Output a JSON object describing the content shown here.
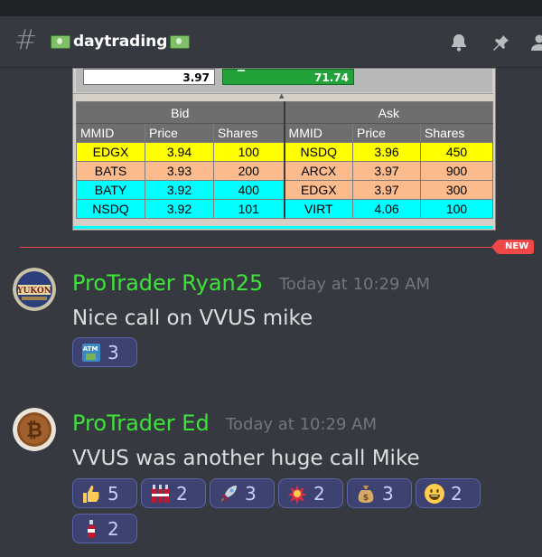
{
  "channel": {
    "name": "daytrading"
  },
  "level2": {
    "top_left_value": "3.97",
    "top_right_value": "71.74",
    "group_headers": [
      "Bid",
      "Ask"
    ],
    "columns": [
      "MMID",
      "Price",
      "Shares",
      "MMID",
      "Price",
      "Shares"
    ],
    "rows": [
      {
        "color": "yellow",
        "cells": [
          "EDGX",
          "3.94",
          "100",
          "NSDQ",
          "3.96",
          "450"
        ]
      },
      {
        "color": "orange",
        "cells": [
          "BATS",
          "3.93",
          "200",
          "ARCX",
          "3.97",
          "900"
        ]
      },
      {
        "color": "cyan",
        "cells": [
          "BATY",
          "3.92",
          "400",
          "EDGX",
          "3.97",
          "300"
        ]
      },
      {
        "color": "cyan",
        "cells": [
          "NSDQ",
          "3.92",
          "101",
          "VIRT",
          "4.06",
          "100"
        ]
      }
    ]
  },
  "divider": {
    "badge": "NEW"
  },
  "messages": [
    {
      "author": "ProTrader Ryan25",
      "timestamp": "Today at 10:29 AM",
      "text": "Nice call on VVUS mike",
      "avatar_icon": "yukon-logo",
      "reactions": [
        {
          "emoji": "atm-icon",
          "count": "3"
        }
      ]
    },
    {
      "author": "ProTrader Ed",
      "timestamp": "Today at 10:29 AM",
      "text": "VVUS was another huge call Mike",
      "avatar_icon": "bitcoin-logo",
      "reactions": [
        {
          "emoji": "thumbs-up-icon",
          "count": "5"
        },
        {
          "emoji": "bottles-icon",
          "count": "2"
        },
        {
          "emoji": "rocket-icon",
          "count": "3"
        },
        {
          "emoji": "boom-icon",
          "count": "2"
        },
        {
          "emoji": "money-bag-icon",
          "count": "3"
        },
        {
          "emoji": "smiley-icon",
          "count": "2"
        },
        {
          "emoji": "bottle-icon",
          "count": "2"
        }
      ]
    }
  ],
  "colors": {
    "author": "#3ee33a",
    "reaction_bg": "#3d4270",
    "new_divider": "#f04747"
  }
}
